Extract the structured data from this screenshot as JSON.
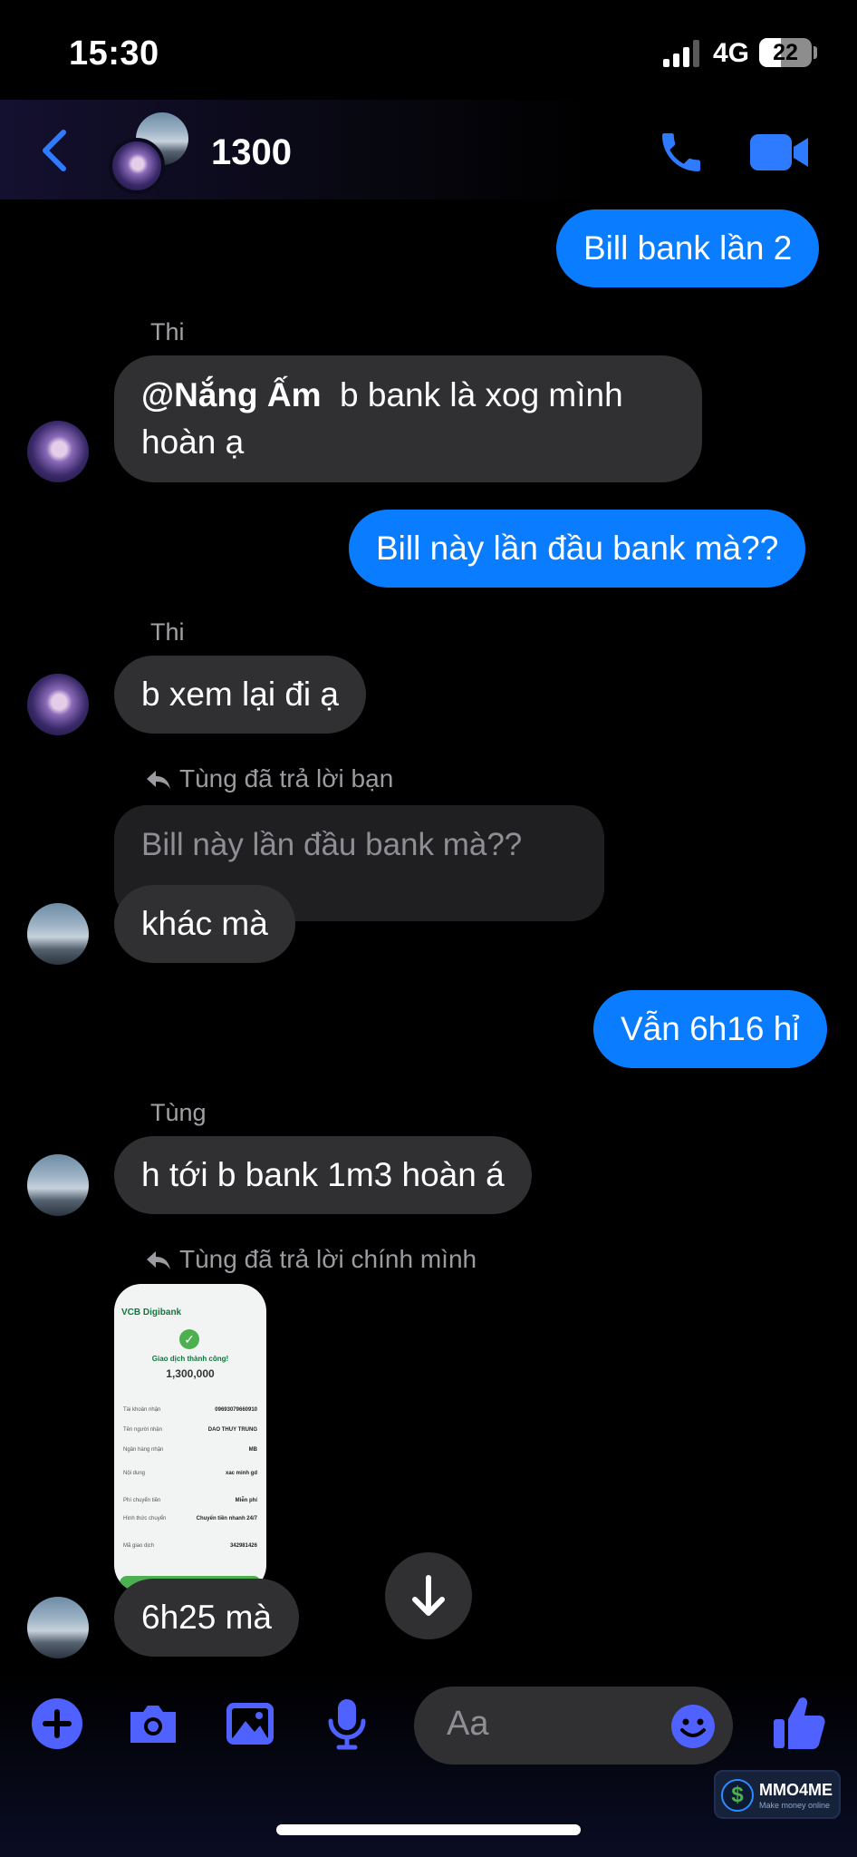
{
  "status_bar": {
    "time": "15:30",
    "network": "4G",
    "battery": "22"
  },
  "header": {
    "title": "1300"
  },
  "messages": {
    "m1": {
      "text": "Bill bank lần 2"
    },
    "m2": {
      "sender": "Thi",
      "mention": "@Nắng Ấm",
      "text_rest": "  b bank là xog mình",
      "text_line2": "hoàn ạ"
    },
    "m3": {
      "text": "Bill này lần đầu bank mà??"
    },
    "m4": {
      "sender": "Thi",
      "text": "b xem lại đi ạ"
    },
    "m5": {
      "reply_label": "Tùng đã trả lời bạn",
      "quoted_text": "Bill này lần đầu bank mà??",
      "text": "khác mà"
    },
    "m6": {
      "text": "Vẫn 6h16 hỉ"
    },
    "m7": {
      "sender": "Tùng",
      "text": "h tới b bank 1m3 hoàn á"
    },
    "m8": {
      "reply_label": "Tùng đã trả lời chính mình",
      "receipt": {
        "bank_logo": "VCB Digibank",
        "status": "Giao dịch thành công!",
        "amount": "1,300,000",
        "rows": [
          {
            "label": "Tài khoản nhận",
            "value": "09693079660910"
          },
          {
            "label": "Tên người nhận",
            "value": "DAO THUY TRUNG"
          },
          {
            "label": "Ngân hàng nhận",
            "value": "MB"
          },
          {
            "label": "Nội dung",
            "value": "xac minh gd"
          },
          {
            "label": "Phí chuyển tiền",
            "value": "Miễn phí"
          },
          {
            "label": "Hình thức chuyển",
            "value": "Chuyển tiền nhanh 24/7"
          },
          {
            "label": "Mã giao dịch",
            "value": "342981426"
          }
        ]
      },
      "text": "6h25 mà"
    }
  },
  "composer": {
    "placeholder": "Aa"
  },
  "watermark": {
    "name": "MMO4ME",
    "tagline": "Make money online",
    "coin_symbol": "$"
  },
  "colors": {
    "accent": "#0a7cff",
    "icon_blue": "#4f62ff",
    "incoming_bubble": "#303033",
    "background": "#000000"
  },
  "icons": [
    "back-chevron",
    "phone",
    "video-camera",
    "reply-arrow",
    "arrow-down",
    "plus",
    "camera",
    "image",
    "microphone",
    "emoji",
    "thumbs-up"
  ]
}
